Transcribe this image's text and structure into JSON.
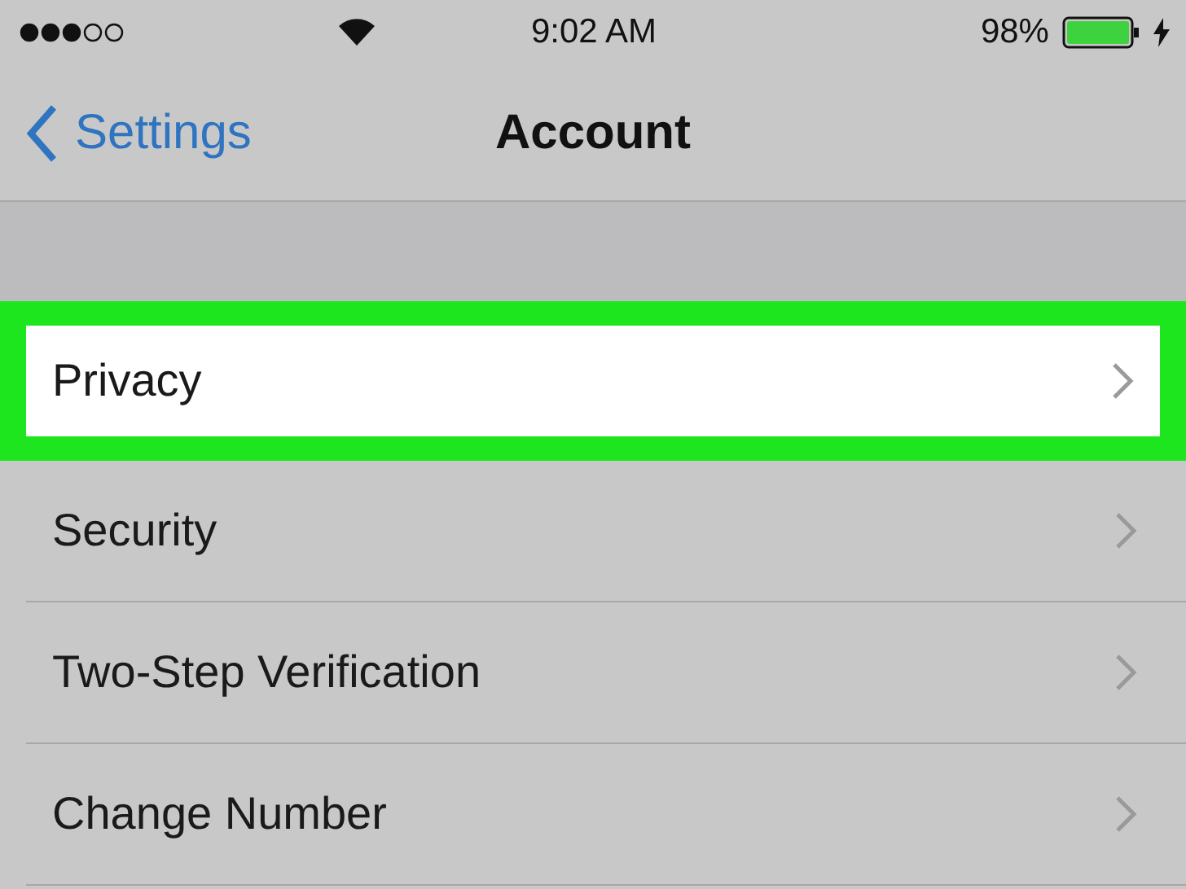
{
  "status_bar": {
    "time": "9:02 AM",
    "battery": "98%"
  },
  "nav": {
    "back": "Settings",
    "title": "Account"
  },
  "rows": [
    {
      "label": "Privacy",
      "selected": true
    },
    {
      "label": "Security",
      "selected": false
    },
    {
      "label": "Two-Step Verification",
      "selected": false
    },
    {
      "label": "Change Number",
      "selected": false
    }
  ]
}
